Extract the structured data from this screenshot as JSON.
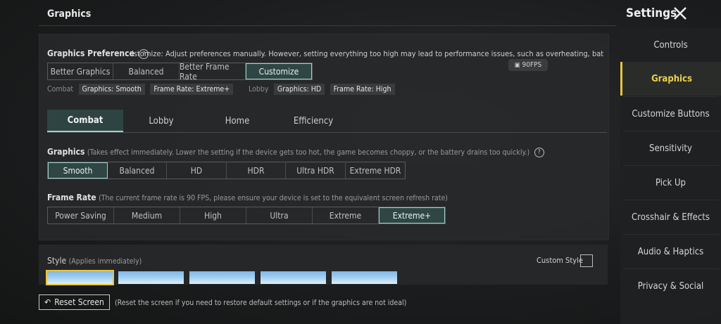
{
  "header": {
    "page_title": "Graphics",
    "settings_title": "Settings"
  },
  "preference": {
    "label": "Graphics Preference",
    "description": "istomize: Adjust preferences manually. However, setting everything too high may lead to performance issues, such as overheating, battery drain, or chop",
    "options": [
      "Better Graphics",
      "Balanced",
      "Better Frame Rate",
      "Customize"
    ],
    "selected": "Customize",
    "combat_label": "Combat",
    "combat_graphics": "Graphics: Smooth",
    "combat_framerate": "Frame Rate: Extreme+",
    "lobby_label": "Lobby",
    "lobby_graphics": "Graphics: HD",
    "lobby_framerate": "Frame Rate: High",
    "fps_badge": "90FPS"
  },
  "tabs": [
    "Combat",
    "Lobby",
    "Home",
    "Efficiency"
  ],
  "graphics": {
    "label": "Graphics",
    "description": "(Takes effect immediately. Lower the setting if the device gets too hot, the game becomes choppy, or the battery drains too quickly.)",
    "options": [
      "Smooth",
      "Balanced",
      "HD",
      "HDR",
      "Ultra HDR",
      "Extreme HDR"
    ],
    "selected": "Smooth"
  },
  "frame_rate": {
    "label": "Frame Rate",
    "description": "(The current frame rate is 90 FPS, please ensure your device is set to the equivalent screen refresh rate)",
    "options": [
      "Power Saving",
      "Medium",
      "High",
      "Ultra",
      "Extreme",
      "Extreme+"
    ],
    "selected": "Extreme+"
  },
  "style": {
    "label": "Style",
    "description": "(Applies immediately)",
    "custom_style_label": "Custom Style"
  },
  "reset": {
    "button_label": "Reset Screen",
    "description": "(Reset the screen if you need to restore default settings or if the graphics are not ideal)"
  },
  "sidebar": {
    "items": [
      "Controls",
      "Graphics",
      "Customize Buttons",
      "Sensitivity",
      "Pick Up",
      "Crosshair & Effects",
      "Audio & Haptics",
      "Privacy & Social"
    ],
    "active": "Graphics"
  },
  "colors": {
    "accent_teal": "#9fd2cc",
    "accent_yellow": "#e9c43c"
  }
}
